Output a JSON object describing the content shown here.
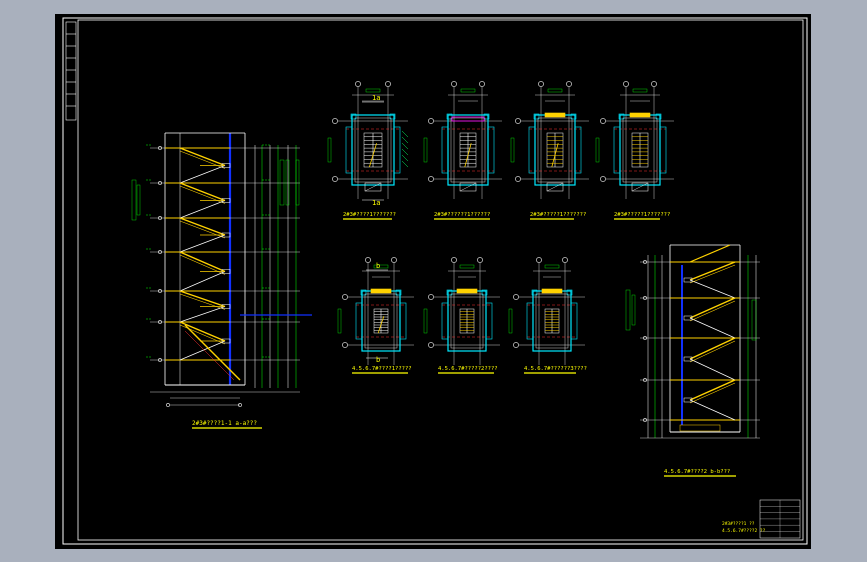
{
  "drawing": {
    "background": "#000000",
    "frame_color": "#ffffff",
    "colors": {
      "stair": "#ffd200",
      "wall": "#00e8ff",
      "grid": "#ff3030",
      "axis": "#ffffff",
      "dim": "#00ff00",
      "hatch": "#00ff60",
      "column": "#1030ff",
      "label": "#ffff00",
      "landing": "#ff00ff"
    }
  },
  "labels": {
    "section_left": "2#3#????1-1 a-a???",
    "plan_1": "2#3#????1???????",
    "plan_2": "2#3#??????1??????",
    "plan_3": "2#3#?????1???????",
    "plan_4": "2#3#?????1???????",
    "plan_5": "4.5.6.7#????1?????",
    "plan_6": "4.5.6.7#?????2????",
    "plan_7": "4.5.6.7#??????3????",
    "section_right": "4.5.6.7#????2 b-b???",
    "title_line1": "2#3#????1 ??",
    "title_line2": "4.5.6.7#????2 ??",
    "section_mark_a_top": "1a",
    "section_mark_a_bottom": "1a",
    "section_mark_b_top": "b",
    "section_mark_b_bottom": "b"
  }
}
